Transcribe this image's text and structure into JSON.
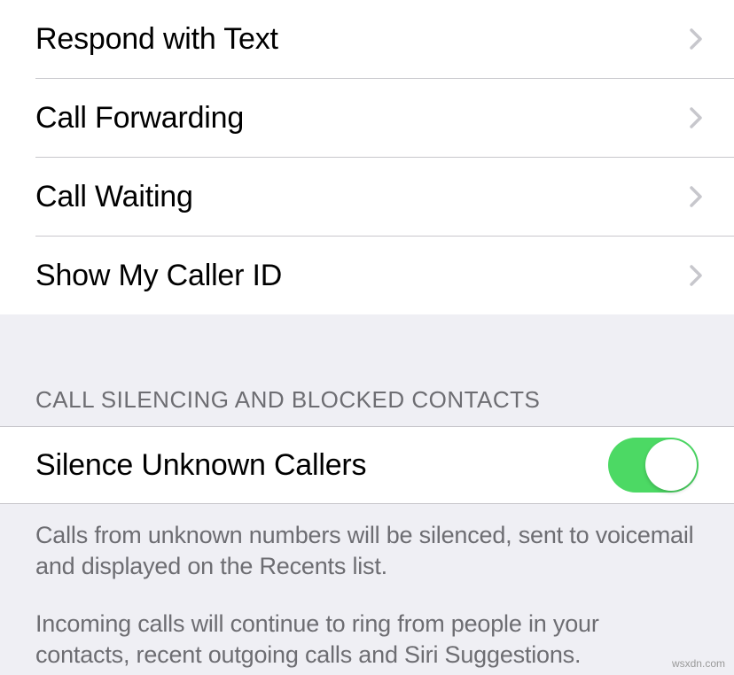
{
  "section1": {
    "rows": [
      {
        "label": "Respond with Text"
      },
      {
        "label": "Call Forwarding"
      },
      {
        "label": "Call Waiting"
      },
      {
        "label": "Show My Caller ID"
      }
    ]
  },
  "section2": {
    "header": "CALL SILENCING AND BLOCKED CONTACTS",
    "toggle": {
      "label": "Silence Unknown Callers",
      "on": true
    },
    "footer": {
      "p1": "Calls from unknown numbers will be silenced, sent to voicemail and displayed on the Recents list.",
      "p2": "Incoming calls will continue to ring from people in your contacts, recent outgoing calls and Siri Suggestions."
    }
  },
  "watermark": "wsxdn.com"
}
